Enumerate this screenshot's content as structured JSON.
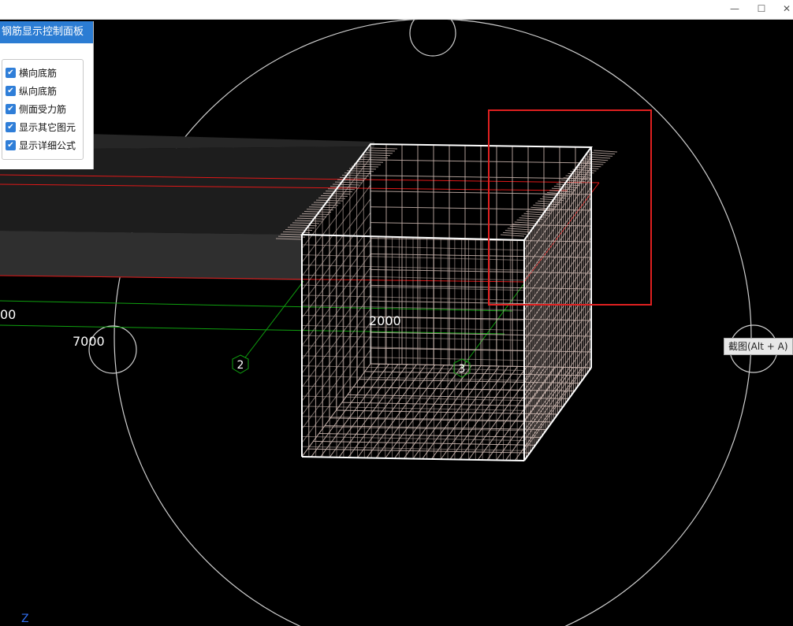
{
  "window": {
    "minimize_glyph": "—",
    "maximize_glyph": "☐",
    "close_glyph": "✕"
  },
  "panel": {
    "title": "钢筋显示控制面板",
    "options": [
      {
        "label": "横向底筋",
        "checked": true
      },
      {
        "label": "纵向底筋",
        "checked": true
      },
      {
        "label": "侧面受力筋",
        "checked": true
      },
      {
        "label": "显示其它图元",
        "checked": true
      },
      {
        "label": "显示详细公式",
        "checked": true
      }
    ]
  },
  "viewport": {
    "dimension_labels": [
      "00",
      "7000",
      "2000"
    ],
    "axis_markers": [
      "2",
      "3"
    ],
    "axis_indicator": "Z",
    "colors": {
      "rebar": "#c9b5ae",
      "outline": "#ffffff",
      "red_line": "#e01818",
      "green_line": "#0fa00f",
      "selection": "#e02020",
      "beam": "#2a2a2a"
    }
  },
  "tooltip": {
    "text": "截图(Alt + A)"
  }
}
